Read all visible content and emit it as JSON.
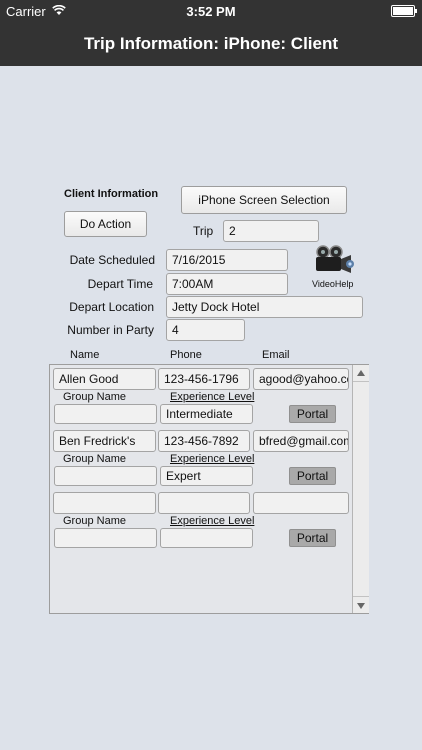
{
  "status": {
    "carrier": "Carrier",
    "time": "3:52 PM"
  },
  "nav": {
    "title": "Trip Information: iPhone: Client"
  },
  "client_info": {
    "heading": "Client Information",
    "do_action_label": "Do Action",
    "screen_selection_label": "iPhone Screen Selection",
    "trip_label": "Trip",
    "trip_value": "2",
    "date_label": "Date Scheduled",
    "date_value": "7/16/2015",
    "depart_time_label": "Depart Time",
    "depart_time_value": "7:00AM",
    "depart_location_label": "Depart Location",
    "depart_location_value": "Jetty Dock Hotel",
    "party_label": "Number in Party",
    "party_value": "4",
    "video_help_label": "VideoHelp"
  },
  "table": {
    "headers": {
      "name": "Name",
      "phone": "Phone",
      "email": "Email"
    },
    "group_label": "Group Name",
    "experience_label": "Experience Level",
    "portal_label": "Portal",
    "rows": [
      {
        "name": "Allen Good",
        "phone": "123-456-1796",
        "email": "agood@yahoo.co",
        "group": "",
        "experience": "Intermediate"
      },
      {
        "name": "Ben Fredrick's",
        "phone": "123-456-7892",
        "email": "bfred@gmail.com",
        "group": "",
        "experience": "Expert"
      },
      {
        "name": "",
        "phone": "",
        "email": "",
        "group": "",
        "experience": ""
      }
    ]
  }
}
